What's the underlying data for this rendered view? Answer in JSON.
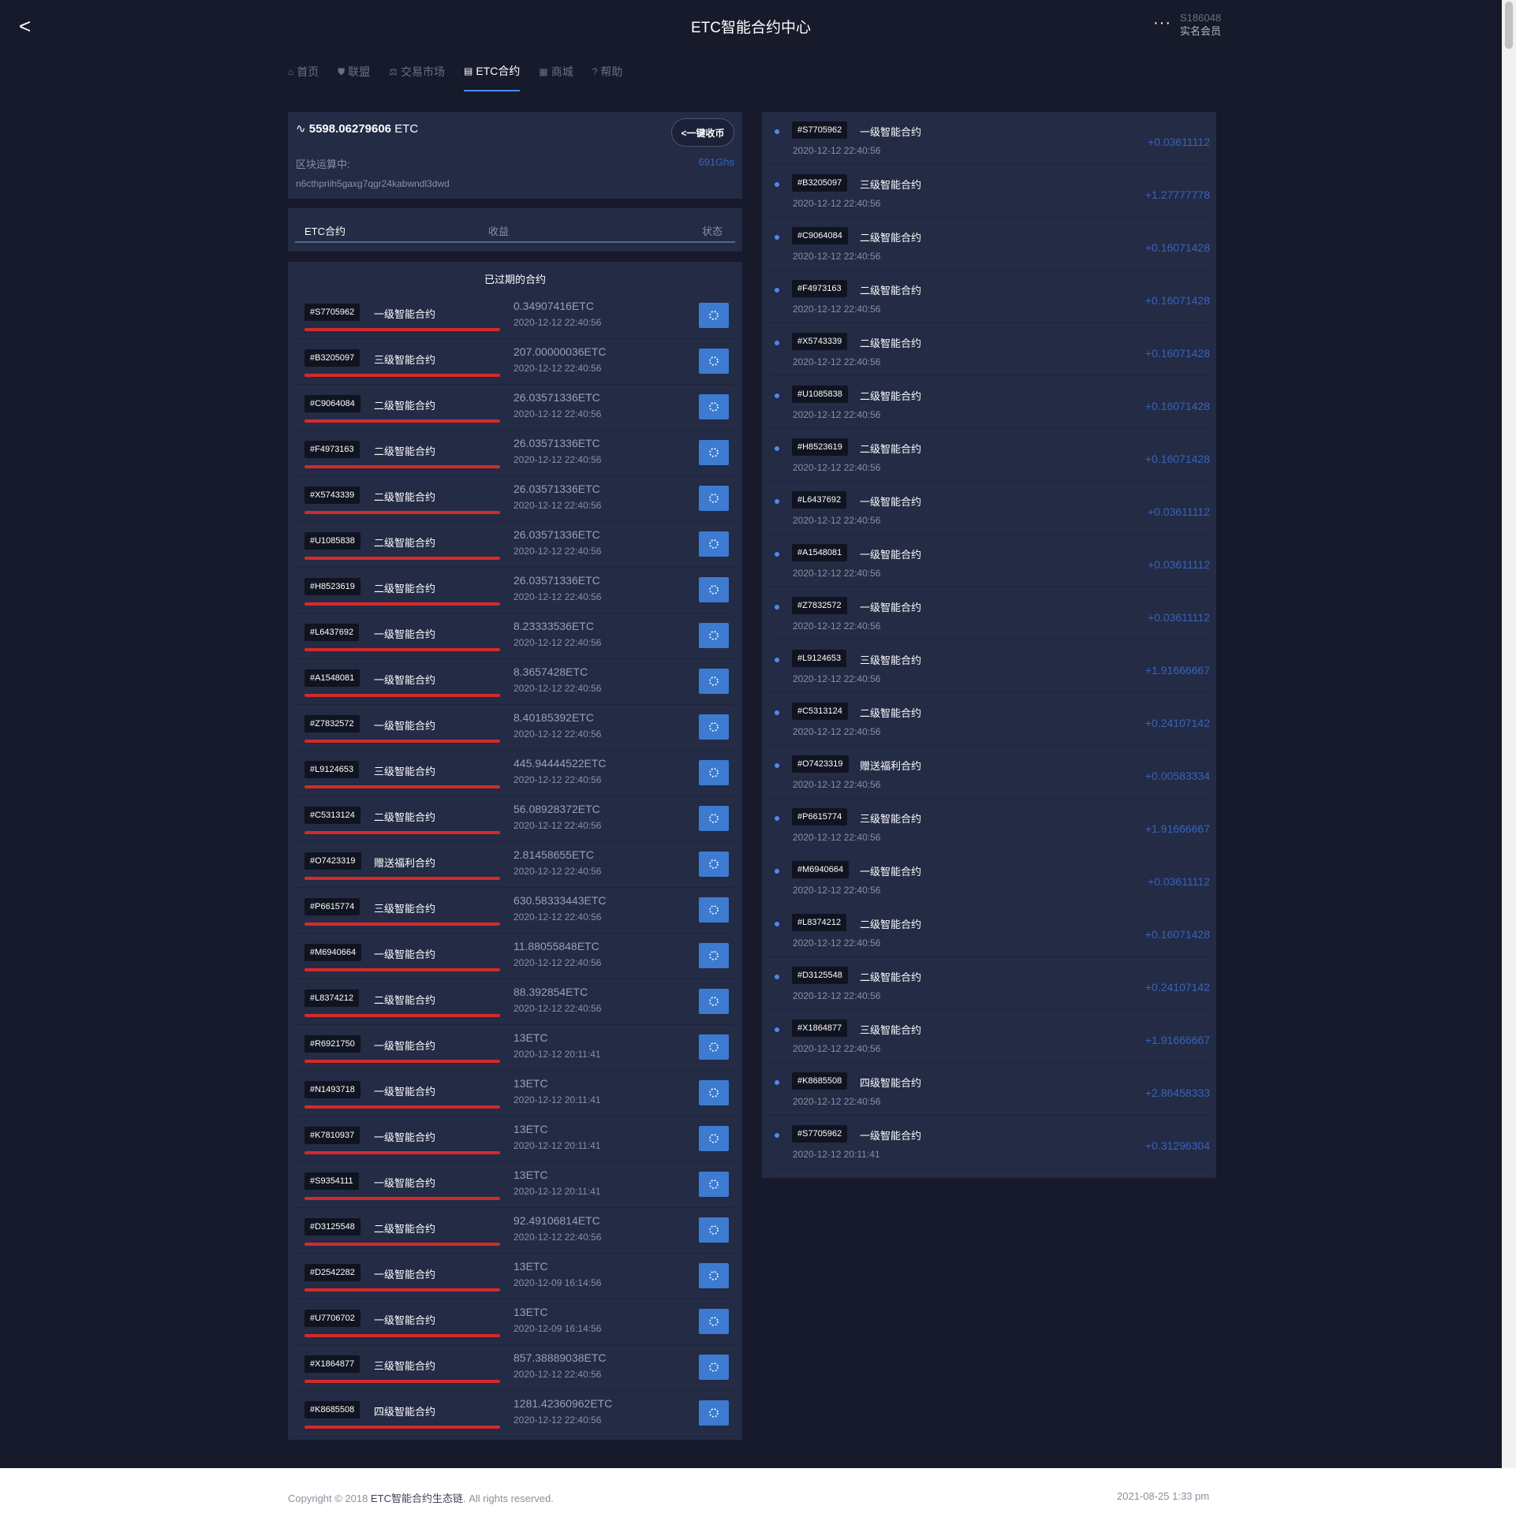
{
  "header": {
    "back_label": "<",
    "title": "ETC智能合约中心",
    "more_label": "···",
    "user_id": "S186048",
    "user_tag": "实名会员"
  },
  "nav": [
    {
      "icon": "⌂",
      "label": "首页",
      "active": false
    },
    {
      "icon": "⛊",
      "label": "联盟",
      "active": false
    },
    {
      "icon": "⚖",
      "label": "交易市场",
      "active": false
    },
    {
      "icon": "▤",
      "label": "ETC合约",
      "active": true
    },
    {
      "icon": "▦",
      "label": "商城",
      "active": false
    },
    {
      "icon": "?",
      "label": "帮助",
      "active": false
    }
  ],
  "wallet": {
    "balance": "5598.06279606",
    "unit": " ETC",
    "collect_label": "<一键收币",
    "running_label": "区块运算中:",
    "speed": "691Ghs",
    "address": "n6cthpriih5gaxg7qgr24kabwndl3dwd"
  },
  "table_header": {
    "c1": "ETC合约",
    "c2": "收益",
    "c3": "状态"
  },
  "expired": {
    "title": "已过期的合约",
    "rows": [
      {
        "code": "#S7705962",
        "level": "一级智能合约",
        "amount": "0.34907416ETC",
        "time": "2020-12-12 22:40:56"
      },
      {
        "code": "#B3205097",
        "level": "三级智能合约",
        "amount": "207.00000036ETC",
        "time": "2020-12-12 22:40:56"
      },
      {
        "code": "#C9064084",
        "level": "二级智能合约",
        "amount": "26.03571336ETC",
        "time": "2020-12-12 22:40:56"
      },
      {
        "code": "#F4973163",
        "level": "二级智能合约",
        "amount": "26.03571336ETC",
        "time": "2020-12-12 22:40:56"
      },
      {
        "code": "#X5743339",
        "level": "二级智能合约",
        "amount": "26.03571336ETC",
        "time": "2020-12-12 22:40:56"
      },
      {
        "code": "#U1085838",
        "level": "二级智能合约",
        "amount": "26.03571336ETC",
        "time": "2020-12-12 22:40:56"
      },
      {
        "code": "#H8523619",
        "level": "二级智能合约",
        "amount": "26.03571336ETC",
        "time": "2020-12-12 22:40:56"
      },
      {
        "code": "#L6437692",
        "level": "一级智能合约",
        "amount": "8.23333536ETC",
        "time": "2020-12-12 22:40:56"
      },
      {
        "code": "#A1548081",
        "level": "一级智能合约",
        "amount": "8.3657428ETC",
        "time": "2020-12-12 22:40:56"
      },
      {
        "code": "#Z7832572",
        "level": "一级智能合约",
        "amount": "8.40185392ETC",
        "time": "2020-12-12 22:40:56"
      },
      {
        "code": "#L9124653",
        "level": "三级智能合约",
        "amount": "445.94444522ETC",
        "time": "2020-12-12 22:40:56"
      },
      {
        "code": "#C5313124",
        "level": "二级智能合约",
        "amount": "56.08928372ETC",
        "time": "2020-12-12 22:40:56"
      },
      {
        "code": "#O7423319",
        "level": "赠送福利合约",
        "amount": "2.81458655ETC",
        "time": "2020-12-12 22:40:56"
      },
      {
        "code": "#P6615774",
        "level": "三级智能合约",
        "amount": "630.58333443ETC",
        "time": "2020-12-12 22:40:56"
      },
      {
        "code": "#M6940664",
        "level": "一级智能合约",
        "amount": "11.88055848ETC",
        "time": "2020-12-12 22:40:56"
      },
      {
        "code": "#L8374212",
        "level": "二级智能合约",
        "amount": "88.392854ETC",
        "time": "2020-12-12 22:40:56"
      },
      {
        "code": "#R6921750",
        "level": "一级智能合约",
        "amount": "13ETC",
        "time": "2020-12-12 20:11:41"
      },
      {
        "code": "#N1493718",
        "level": "一级智能合约",
        "amount": "13ETC",
        "time": "2020-12-12 20:11:41"
      },
      {
        "code": "#K7810937",
        "level": "一级智能合约",
        "amount": "13ETC",
        "time": "2020-12-12 20:11:41"
      },
      {
        "code": "#S9354111",
        "level": "一级智能合约",
        "amount": "13ETC",
        "time": "2020-12-12 20:11:41"
      },
      {
        "code": "#D3125548",
        "level": "二级智能合约",
        "amount": "92.49106814ETC",
        "time": "2020-12-12 22:40:56"
      },
      {
        "code": "#D2542282",
        "level": "一级智能合约",
        "amount": "13ETC",
        "time": "2020-12-09 16:14:56"
      },
      {
        "code": "#U7706702",
        "level": "一级智能合约",
        "amount": "13ETC",
        "time": "2020-12-09 16:14:56"
      },
      {
        "code": "#X1864877",
        "level": "三级智能合约",
        "amount": "857.38889038ETC",
        "time": "2020-12-12 22:40:56"
      },
      {
        "code": "#K8685508",
        "level": "四级智能合约",
        "amount": "1281.42360962ETC",
        "time": "2020-12-12 22:40:56"
      }
    ]
  },
  "earnings": [
    {
      "code": "#S7705962",
      "level": "一级智能合约",
      "time": "2020-12-12 22:40:56",
      "gain": "+0.03611112"
    },
    {
      "code": "#B3205097",
      "level": "三级智能合约",
      "time": "2020-12-12 22:40:56",
      "gain": "+1.27777778"
    },
    {
      "code": "#C9064084",
      "level": "二级智能合约",
      "time": "2020-12-12 22:40:56",
      "gain": "+0.16071428"
    },
    {
      "code": "#F4973163",
      "level": "二级智能合约",
      "time": "2020-12-12 22:40:56",
      "gain": "+0.16071428"
    },
    {
      "code": "#X5743339",
      "level": "二级智能合约",
      "time": "2020-12-12 22:40:56",
      "gain": "+0.16071428"
    },
    {
      "code": "#U1085838",
      "level": "二级智能合约",
      "time": "2020-12-12 22:40:56",
      "gain": "+0.16071428"
    },
    {
      "code": "#H8523619",
      "level": "二级智能合约",
      "time": "2020-12-12 22:40:56",
      "gain": "+0.16071428"
    },
    {
      "code": "#L6437692",
      "level": "一级智能合约",
      "time": "2020-12-12 22:40:56",
      "gain": "+0.03611112"
    },
    {
      "code": "#A1548081",
      "level": "一级智能合约",
      "time": "2020-12-12 22:40:56",
      "gain": "+0.03611112"
    },
    {
      "code": "#Z7832572",
      "level": "一级智能合约",
      "time": "2020-12-12 22:40:56",
      "gain": "+0.03611112"
    },
    {
      "code": "#L9124653",
      "level": "三级智能合约",
      "time": "2020-12-12 22:40:56",
      "gain": "+1.91666667"
    },
    {
      "code": "#C5313124",
      "level": "二级智能合约",
      "time": "2020-12-12 22:40:56",
      "gain": "+0.24107142"
    },
    {
      "code": "#O7423319",
      "level": "赠送福利合约",
      "time": "2020-12-12 22:40:56",
      "gain": "+0.00583334"
    },
    {
      "code": "#P6615774",
      "level": "三级智能合约",
      "time": "2020-12-12 22:40:56",
      "gain": "+1.91666667"
    },
    {
      "code": "#M6940664",
      "level": "一级智能合约",
      "time": "2020-12-12 22:40:56",
      "gain": "+0.03611112"
    },
    {
      "code": "#L8374212",
      "level": "二级智能合约",
      "time": "2020-12-12 22:40:56",
      "gain": "+0.16071428"
    },
    {
      "code": "#D3125548",
      "level": "二级智能合约",
      "time": "2020-12-12 22:40:56",
      "gain": "+0.24107142"
    },
    {
      "code": "#X1864877",
      "level": "三级智能合约",
      "time": "2020-12-12 22:40:56",
      "gain": "+1.91666667"
    },
    {
      "code": "#K8685508",
      "level": "四级智能合约",
      "time": "2020-12-12 22:40:56",
      "gain": "+2.86458333"
    },
    {
      "code": "#S7705962",
      "level": "一级智能合约",
      "time": "2020-12-12 20:11:41",
      "gain": "+0.31296304"
    }
  ],
  "footer": {
    "copy_prefix": "Copyright © 2018 ",
    "brand": "ETC智能合约生态链",
    "copy_suffix": ". All rights reserved.",
    "date": "2021-08-25 1:33 pm"
  },
  "colors": {
    "background": "#161a2a",
    "panel": "#232b45",
    "accent": "#4a8cf0",
    "button": "#3d7bd1",
    "bar": "#d52a2a",
    "gain": "#3a63b8"
  }
}
